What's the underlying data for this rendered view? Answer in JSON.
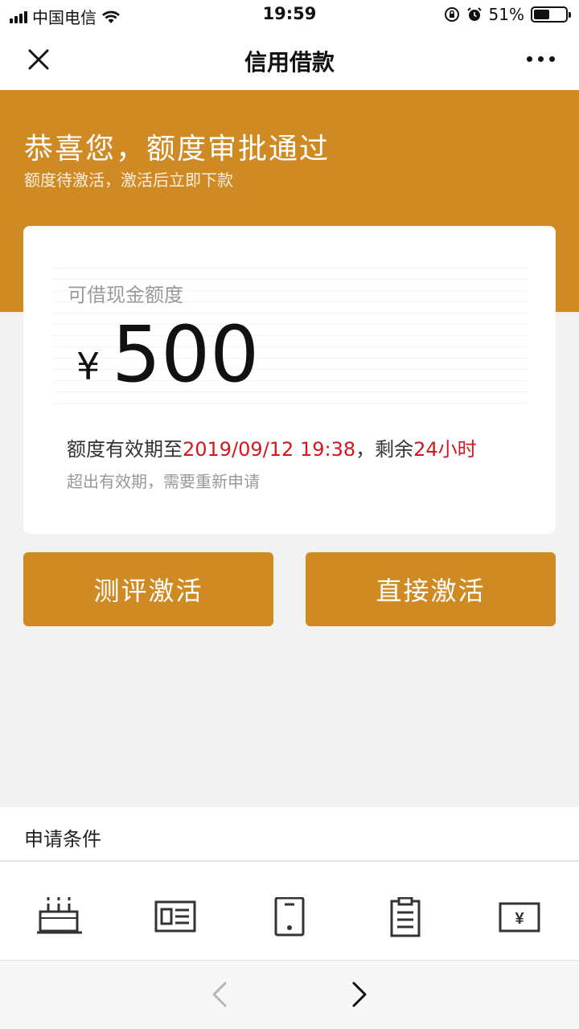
{
  "status_bar": {
    "carrier": "中国电信",
    "time": "19:59",
    "battery": "51%",
    "battery_level": 0.51
  },
  "nav": {
    "title": "信用借款",
    "close_icon": "close-icon",
    "more_icon": "more-icon"
  },
  "banner": {
    "title": "恭喜您，额度审批通过",
    "subtitle": "额度待激活，激活后立即下款",
    "color": "#d08a24"
  },
  "card": {
    "label": "可借现金额度",
    "currency": "¥",
    "amount": "500",
    "validity_prefix": "额度有效期至",
    "validity_date": "2019/09/12 19:38",
    "validity_mid": "，剩余",
    "validity_remaining": "24小时",
    "note": "超出有效期，需要重新申请",
    "highlight_color": "#d5161e"
  },
  "buttons": {
    "evaluate": "测评激活",
    "direct": "直接激活"
  },
  "conditions": {
    "title": "申请条件",
    "icons": [
      "cake-icon",
      "id-card-icon",
      "phone-icon",
      "clipboard-icon",
      "bank-card-icon"
    ]
  }
}
